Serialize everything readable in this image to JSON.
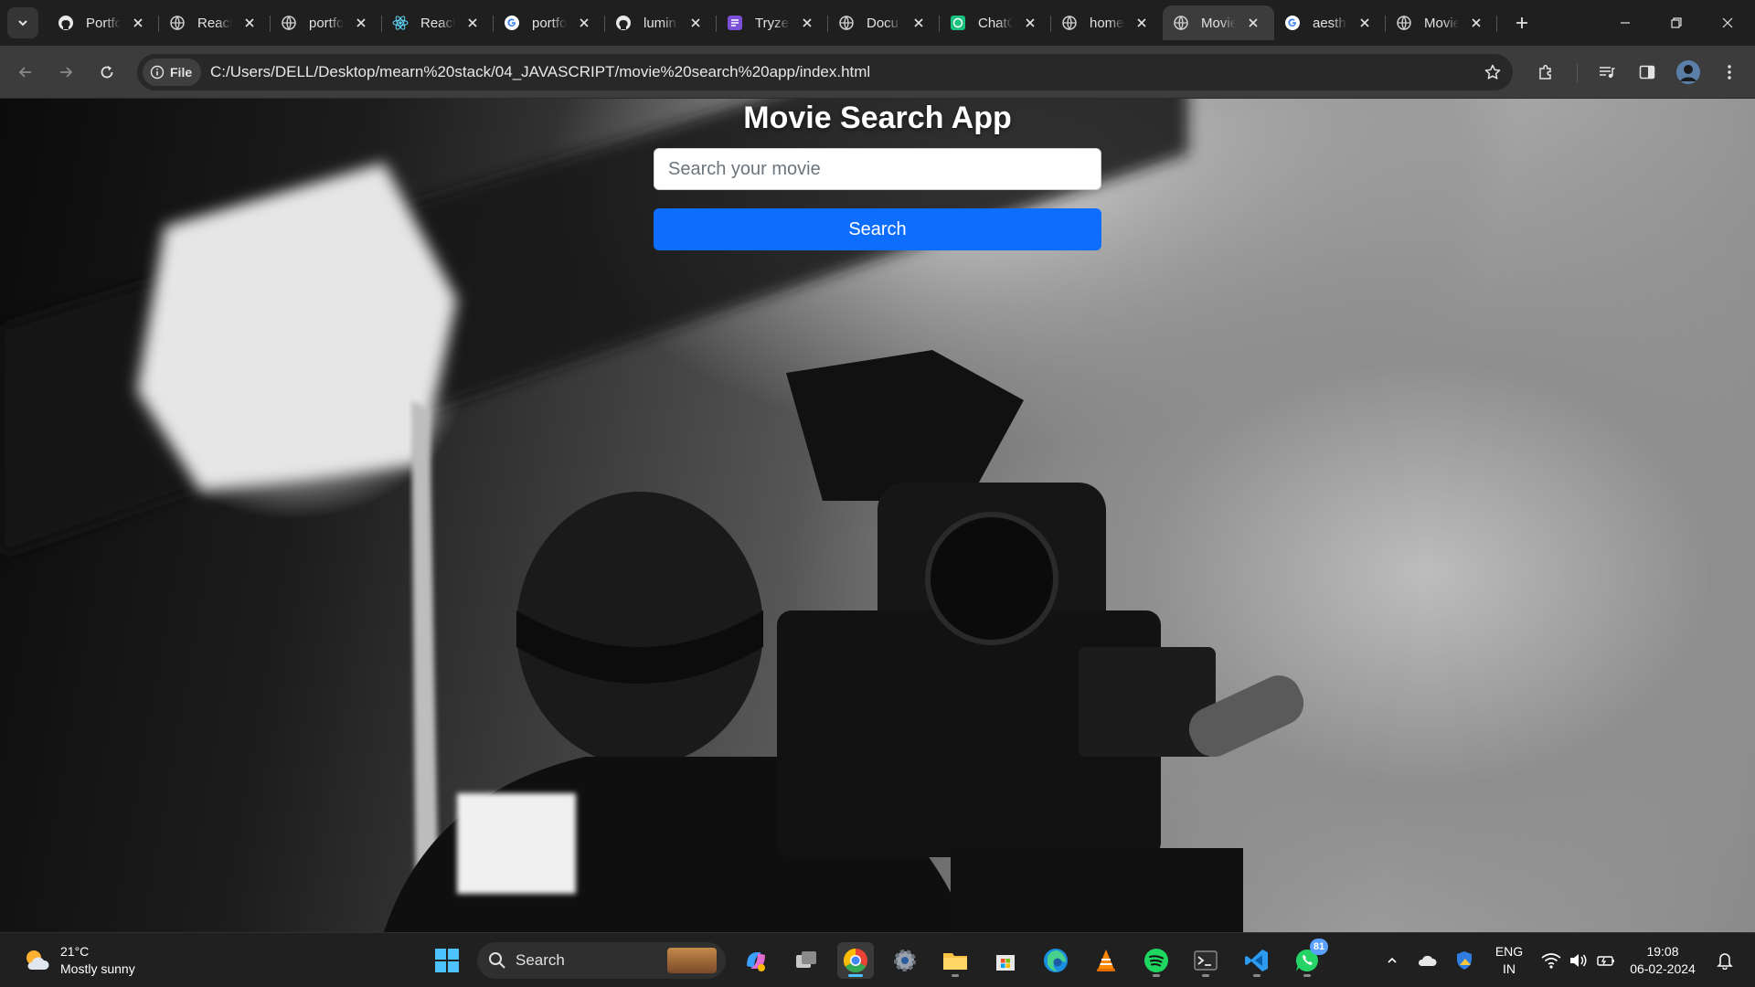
{
  "browser": {
    "tabs": [
      {
        "label": "Portfolio",
        "favicon": "github-icon"
      },
      {
        "label": "React",
        "favicon": "globe-icon"
      },
      {
        "label": "portfolio",
        "favicon": "globe-icon"
      },
      {
        "label": "React",
        "favicon": "react-icon"
      },
      {
        "label": "portfolio",
        "favicon": "google-icon"
      },
      {
        "label": "lumin",
        "favicon": "github-icon"
      },
      {
        "label": "Tryzen",
        "favicon": "tryzen-icon"
      },
      {
        "label": "Docu",
        "favicon": "globe-icon"
      },
      {
        "label": "ChatGPT",
        "favicon": "chatgpt-icon"
      },
      {
        "label": "home",
        "favicon": "globe-icon"
      },
      {
        "label": "Movie",
        "favicon": "globe-icon",
        "active": true
      },
      {
        "label": "aesth",
        "favicon": "google-icon"
      },
      {
        "label": "Movie",
        "favicon": "globe-icon"
      }
    ],
    "address_bar": {
      "chip_label": "File",
      "url": "C:/Users/DELL/Desktop/mearn%20stack/04_JAVASCRIPT/movie%20search%20app/index.html"
    }
  },
  "app": {
    "title": "Movie Search App",
    "search_placeholder": "Search your movie",
    "search_value": "",
    "search_button": "Search",
    "colors": {
      "button": "#0d6efd",
      "title": "#ffffff"
    }
  },
  "taskbar": {
    "weather": {
      "temp": "21°C",
      "condition": "Mostly sunny"
    },
    "search_label": "Search",
    "whatsapp_badge": "81",
    "language": {
      "line1": "ENG",
      "line2": "IN"
    },
    "clock": {
      "time": "19:08",
      "date": "06-02-2024"
    },
    "colors": {
      "accent": "#4cc2ff"
    }
  }
}
